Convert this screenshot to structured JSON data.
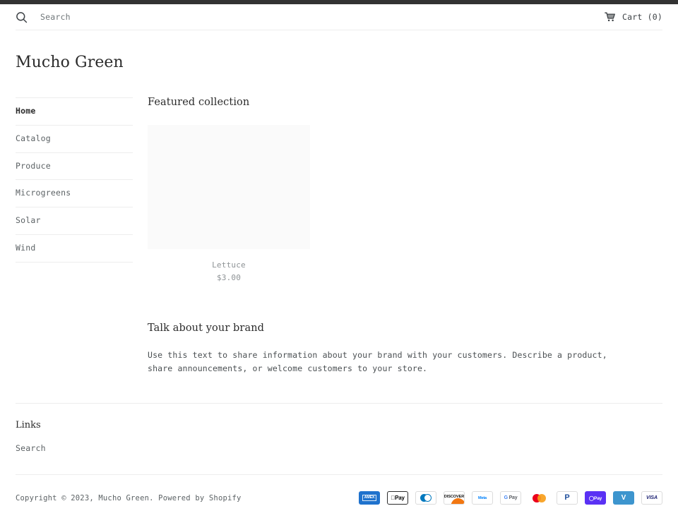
{
  "header": {
    "search_icon": "search-icon",
    "search_placeholder": "Search",
    "cart_icon": "shopping-cart-icon",
    "cart_label": "Cart (0)"
  },
  "store": {
    "title": "Mucho Green"
  },
  "sidebar": {
    "items": [
      {
        "label": "Home",
        "active": true
      },
      {
        "label": "Catalog",
        "active": false
      },
      {
        "label": "Produce",
        "active": false
      },
      {
        "label": "Microgreens",
        "active": false
      },
      {
        "label": "Solar",
        "active": false
      },
      {
        "label": "Wind",
        "active": false
      }
    ]
  },
  "featured": {
    "heading": "Featured collection",
    "products": [
      {
        "name": "Lettuce",
        "price": "$3.00"
      }
    ]
  },
  "brand": {
    "heading": "Talk about your brand",
    "body": "Use this text to share information about your brand with your customers. Describe a product, share announcements, or welcome customers to your store."
  },
  "footer": {
    "links_heading": "Links",
    "links": [
      {
        "label": "Search"
      }
    ],
    "copyright": "Copyright © 2023, Mucho Green. Powered by Shopify",
    "payment_methods": [
      {
        "name": "american-express",
        "text": "AMEX"
      },
      {
        "name": "apple-pay",
        "text": "Pay"
      },
      {
        "name": "diners-club",
        "text": ""
      },
      {
        "name": "discover",
        "text": "DISCOVER"
      },
      {
        "name": "meta-pay",
        "text": "Meta"
      },
      {
        "name": "google-pay",
        "text": "Pay"
      },
      {
        "name": "mastercard",
        "text": ""
      },
      {
        "name": "paypal",
        "text": "P"
      },
      {
        "name": "shop-pay",
        "text": "Pay"
      },
      {
        "name": "venmo",
        "text": "V"
      },
      {
        "name": "visa",
        "text": "VISA"
      }
    ]
  },
  "colors": {
    "topbar": "#333333",
    "rule": "#ededed",
    "text": "#3d4246",
    "muted": "#8d9295",
    "placeholder_image": "#fafafa"
  }
}
